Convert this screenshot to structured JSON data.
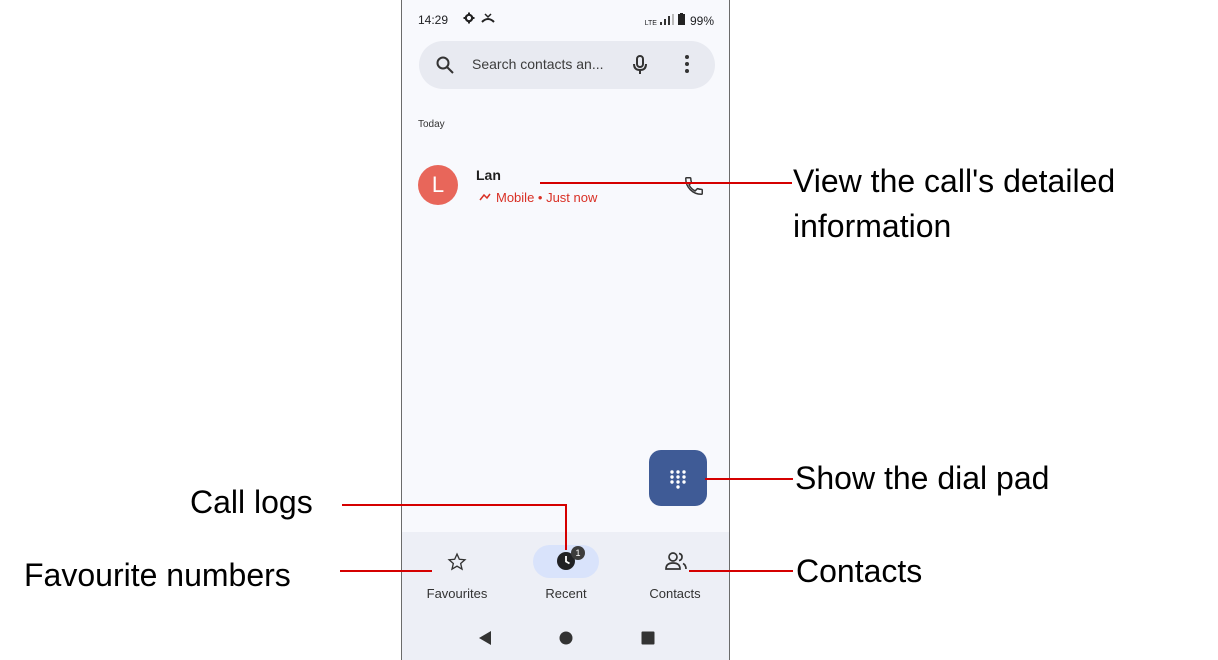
{
  "status_bar": {
    "time": "14:29",
    "network": "LTE",
    "battery": "99%"
  },
  "search": {
    "placeholder": "Search contacts an..."
  },
  "recent_calls": {
    "section_label": "Today",
    "items": [
      {
        "avatar_letter": "L",
        "name": "Lan",
        "details": "Mobile • Just now",
        "avatar_color": "#e8665a"
      }
    ]
  },
  "bottom_nav": {
    "items": [
      {
        "label": "Favourites",
        "icon": "star-icon"
      },
      {
        "label": "Recent",
        "icon": "clock-icon",
        "badge": "1"
      },
      {
        "label": "Contacts",
        "icon": "people-icon"
      }
    ]
  },
  "annotations": {
    "call_detail": [
      "View the call's detailed",
      "information"
    ],
    "dial_pad": "Show the dial pad",
    "call_logs": "Call logs",
    "favourites": "Favourite numbers",
    "contacts": "Contacts"
  },
  "colors": {
    "accent": "#3f5b96",
    "annotation_line": "#d50000",
    "missed_call": "#d93025"
  }
}
